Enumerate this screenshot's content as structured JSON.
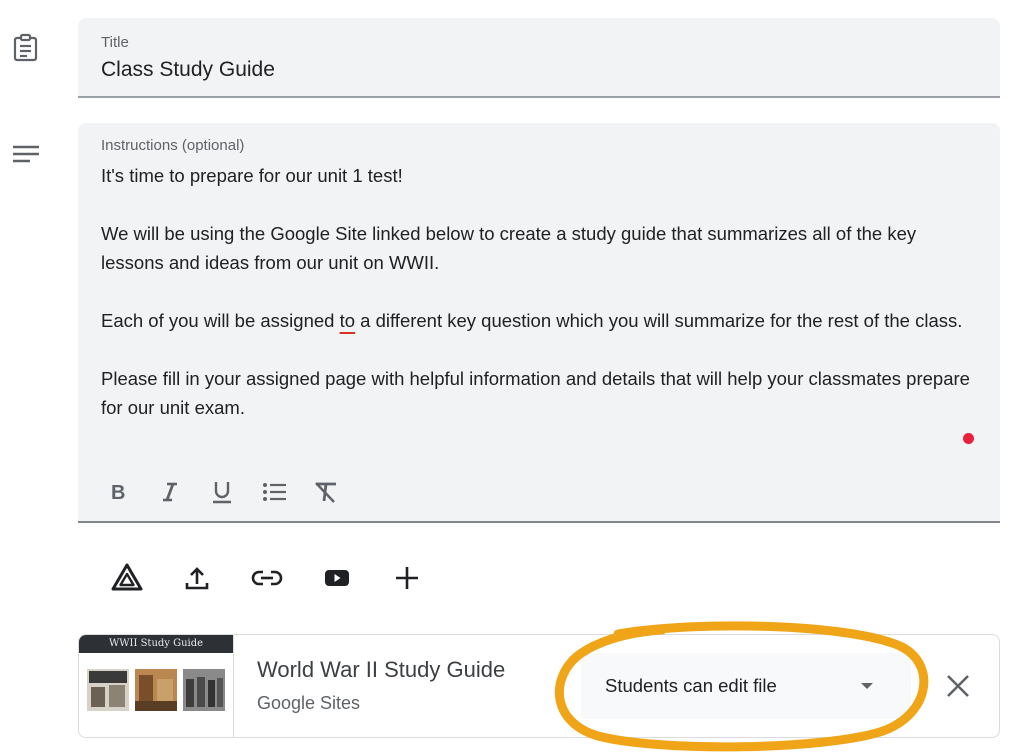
{
  "title_field": {
    "label": "Title",
    "value": "Class Study Guide"
  },
  "instructions_field": {
    "label": "Instructions (optional)",
    "line1": "It's time to prepare for our unit 1 test!",
    "para2": "We will be using the Google Site linked below to create a study guide that summarizes all of the key lessons and ideas from our unit on WWII.",
    "para3_before": "Each of you will be assigned ",
    "para3_word": "to",
    "para3_after": " a different key question which you will summarize for the rest of the class.",
    "para4": "Please fill in your assigned page with helpful information and details that will help your classmates prepare for our unit exam."
  },
  "format_toolbar": [
    "bold-icon",
    "italic-icon",
    "underline-icon",
    "bulleted-list-icon",
    "clear-formatting-icon"
  ],
  "attach_toolbar": [
    "google-drive-icon",
    "upload-icon",
    "link-icon",
    "youtube-icon",
    "add-icon"
  ],
  "attachment": {
    "thumbnail_banner": "WWII Study Guide",
    "title": "World War II Study Guide",
    "type": "Google Sites",
    "permission": "Students can edit file"
  },
  "colors": {
    "highlight": "#f0a417",
    "field_bg": "#f1f3f4",
    "spell_error": "#d93025"
  }
}
